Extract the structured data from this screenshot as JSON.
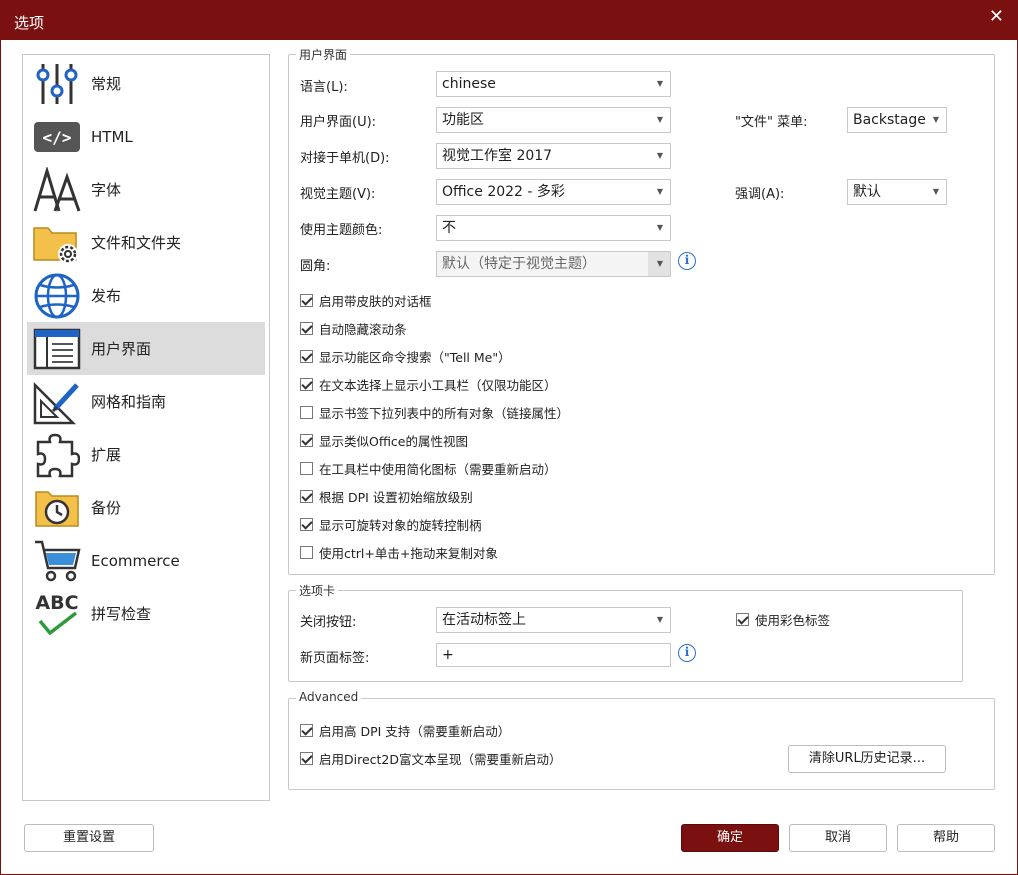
{
  "window": {
    "title": "选项",
    "close_glyph": "✕"
  },
  "sidebar": {
    "items": [
      {
        "label": "常规",
        "icon": "sliders-icon"
      },
      {
        "label": "HTML",
        "icon": "code-icon"
      },
      {
        "label": "字体",
        "icon": "font-icon"
      },
      {
        "label": "文件和文件夹",
        "icon": "folder-gear-icon"
      },
      {
        "label": "发布",
        "icon": "globe-icon"
      },
      {
        "label": "用户界面",
        "icon": "window-icon",
        "selected": true
      },
      {
        "label": "网格和指南",
        "icon": "ruler-pencil-icon"
      },
      {
        "label": "扩展",
        "icon": "puzzle-icon"
      },
      {
        "label": "备份",
        "icon": "backup-clock-icon"
      },
      {
        "label": "Ecommerce",
        "icon": "cart-icon"
      },
      {
        "label": "拼写检查",
        "icon": "spellcheck-icon"
      }
    ]
  },
  "ui_group": {
    "title": "用户界面",
    "language_label": "语言(L):",
    "language_value": "chinese",
    "ui_label": "用户界面(U):",
    "ui_value": "功能区",
    "file_menu_label": "\"文件\" 菜单:",
    "file_menu_value": "Backstage",
    "dock_label": "对接于单机(D):",
    "dock_value": "视觉工作室 2017",
    "theme_label": "视觉主题(V):",
    "theme_value": "Office 2022 - 多彩",
    "accent_label": "强调(A):",
    "accent_value": "默认",
    "theme_color_label": "使用主题颜色:",
    "theme_color_value": "不",
    "corner_label": "圆角:",
    "corner_value": "默认（特定于视觉主题）",
    "checkboxes": [
      {
        "label": "启用带皮肤的对话框",
        "checked": true
      },
      {
        "label": "自动隐藏滚动条",
        "checked": true
      },
      {
        "label": "显示功能区命令搜索（\"Tell Me\"）",
        "checked": true
      },
      {
        "label": "在文本选择上显示小工具栏（仅限功能区）",
        "checked": true
      },
      {
        "label": "显示书签下拉列表中的所有对象（链接属性）",
        "checked": false
      },
      {
        "label": "显示类似Office的属性视图",
        "checked": true
      },
      {
        "label": "在工具栏中使用简化图标（需要重新启动）",
        "checked": false
      },
      {
        "label": "根据 DPI 设置初始缩放级别",
        "checked": true
      },
      {
        "label": "显示可旋转对象的旋转控制柄",
        "checked": true
      },
      {
        "label": "使用ctrl+单击+拖动来复制对象",
        "checked": false
      }
    ]
  },
  "tabs_group": {
    "title": "选项卡",
    "close_button_label": "关闭按钮:",
    "close_button_value": "在活动标签上",
    "color_tabs_label": "使用彩色标签",
    "color_tabs_checked": true,
    "new_tab_label": "新页面标签:",
    "new_tab_value": "+"
  },
  "advanced_group": {
    "title": "Advanced",
    "checkboxes": [
      {
        "label": "启用高 DPI 支持（需要重新启动）",
        "checked": true
      },
      {
        "label": "启用Direct2D富文本呈现（需要重新启动）",
        "checked": true
      }
    ],
    "clear_url_label": "清除URL历史记录..."
  },
  "footer": {
    "reset_label": "重置设置",
    "ok_label": "确定",
    "cancel_label": "取消",
    "help_label": "帮助"
  },
  "colors": {
    "accent": "#7a1010",
    "info": "#2a6fd0"
  }
}
